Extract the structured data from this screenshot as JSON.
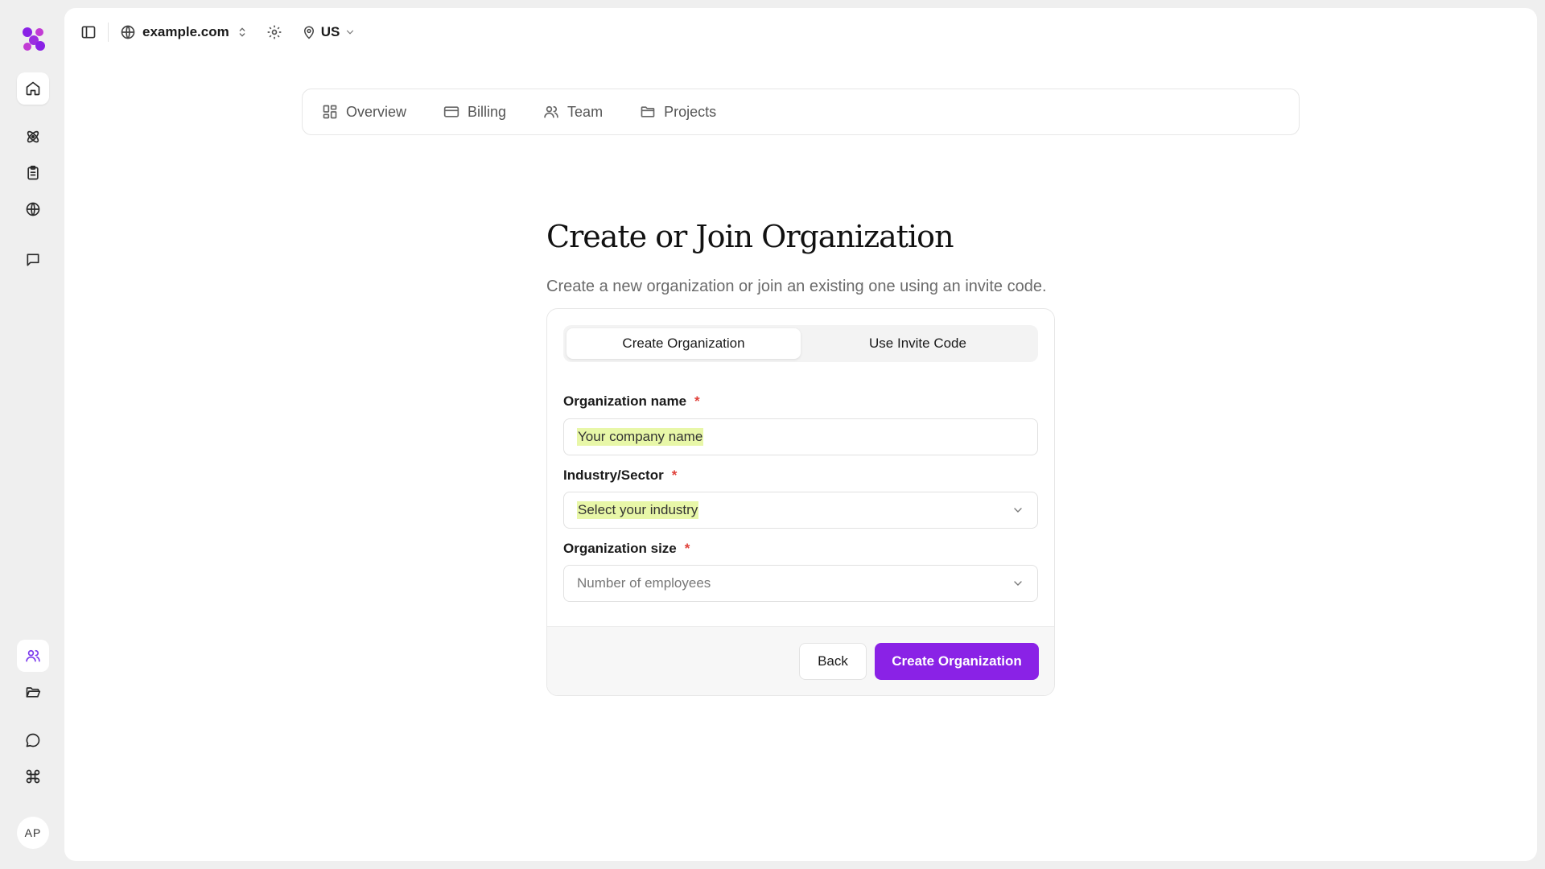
{
  "topbar": {
    "domain": "example.com",
    "region": "US"
  },
  "tabs": [
    {
      "label": "Overview",
      "icon": "dashboard-icon"
    },
    {
      "label": "Billing",
      "icon": "credit-card-icon"
    },
    {
      "label": "Team",
      "icon": "users-icon"
    },
    {
      "label": "Projects",
      "icon": "folder-icon"
    }
  ],
  "page": {
    "title": "Create or Join Organization",
    "subtitle": "Create a new organization or join an existing one using an invite code."
  },
  "segmented": {
    "create": "Create Organization",
    "invite": "Use Invite Code"
  },
  "form": {
    "org_name": {
      "label": "Organization name",
      "required": "*",
      "placeholder": "Your company name"
    },
    "industry": {
      "label": "Industry/Sector",
      "required": "*",
      "placeholder": "Select your industry"
    },
    "size": {
      "label": "Organization size",
      "required": "*",
      "placeholder": "Number of employees"
    }
  },
  "footer": {
    "back": "Back",
    "create": "Create Organization"
  },
  "user": {
    "initials": "AP"
  },
  "colors": {
    "accent": "#8a22e6",
    "highlight": "#e8f7a8",
    "required": "#e0413a"
  }
}
